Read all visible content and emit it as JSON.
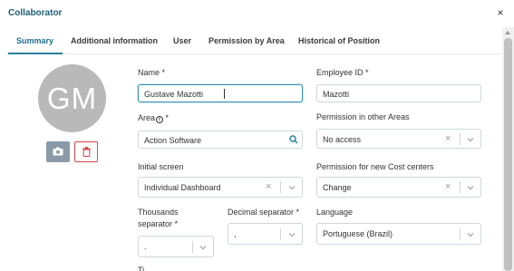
{
  "dialog": {
    "title": "Collaborator",
    "close_glyph": "×"
  },
  "tabs": [
    {
      "label": "Summary",
      "active": true
    },
    {
      "label": "Additional information"
    },
    {
      "label": "User"
    },
    {
      "label": "Permission by Area"
    },
    {
      "label": "Historical of Position"
    }
  ],
  "avatar": {
    "initials": "GM"
  },
  "form": {
    "name": {
      "label": "Name *",
      "value": "Gustave Mazotti"
    },
    "employee_id": {
      "label": "Employee ID *",
      "value": "Mazotti"
    },
    "area": {
      "label": "Area",
      "required": "*",
      "value": "Action Software"
    },
    "permission_other_areas": {
      "label": "Permission in other Areas",
      "value": "No access"
    },
    "initial_screen": {
      "label": "Initial screen",
      "value": "Individual Dashboard"
    },
    "permission_cost_centers": {
      "label": "Permission for new Cost centers",
      "value": "Change"
    },
    "thousands_separator": {
      "label_line1": "Thousands",
      "label_line2": "separator *",
      "value": "."
    },
    "decimal_separator": {
      "label": "Decimal separator *",
      "value": ","
    },
    "language": {
      "label": "Language",
      "value": "Portuguese (Brazil)"
    },
    "next_label_partial": "Ti..."
  },
  "icons": {
    "close": "close-icon",
    "camera": "camera-icon",
    "trash": "trash-icon",
    "info": "info-icon",
    "search": "search-icon",
    "chevron": "chevron-down-icon",
    "clear": "clear-icon"
  },
  "colors": {
    "accent": "#1f6f8b",
    "title": "#1f5e7a",
    "danger": "#d8454b",
    "avatar_bg": "#b9b9b9",
    "photo_btn": "#8a9ba8"
  }
}
